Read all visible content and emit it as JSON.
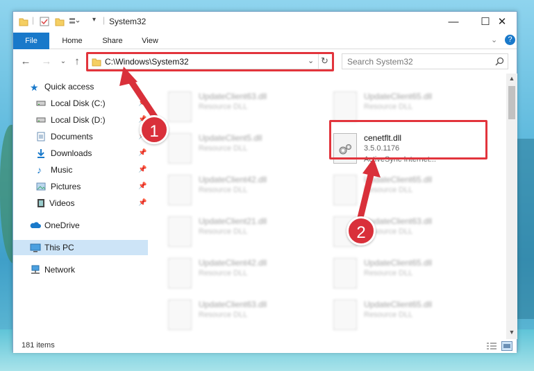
{
  "window": {
    "title": "System32",
    "controls": {
      "minimize": "—",
      "maximize": "☐",
      "close": "✕"
    }
  },
  "ribbon": {
    "tabs": [
      "File",
      "Home",
      "Share",
      "View"
    ]
  },
  "address": {
    "path": "C:\\Windows\\System32",
    "search_placeholder": "Search System32"
  },
  "nav": {
    "items": [
      {
        "label": "Quick access",
        "icon": "star-icon",
        "pinned": false
      },
      {
        "label": "Local Disk (C:)",
        "icon": "drive-icon",
        "pinned": true
      },
      {
        "label": "Local Disk (D:)",
        "icon": "drive-icon",
        "pinned": true
      },
      {
        "label": "Documents",
        "icon": "documents-icon",
        "pinned": true
      },
      {
        "label": "Downloads",
        "icon": "download-icon",
        "pinned": true
      },
      {
        "label": "Music",
        "icon": "music-icon",
        "pinned": true
      },
      {
        "label": "Pictures",
        "icon": "pictures-icon",
        "pinned": true
      },
      {
        "label": "Videos",
        "icon": "video-icon",
        "pinned": true
      },
      {
        "label": "OneDrive",
        "icon": "cloud-icon",
        "pinned": false
      },
      {
        "label": "This PC",
        "icon": "pc-icon",
        "pinned": false
      },
      {
        "label": "Network",
        "icon": "network-icon",
        "pinned": false
      }
    ],
    "selected": "This PC"
  },
  "files": {
    "left": [
      {
        "name": "UpdateClient63.dll",
        "desc": "Resource DLL"
      },
      {
        "name": "UpdateClient5.dll",
        "desc": "Resource DLL"
      },
      {
        "name": "UpdateClient42.dll",
        "desc": "Resource DLL"
      },
      {
        "name": "UpdateClient21.dll",
        "desc": "Resource DLL"
      },
      {
        "name": "UpdateClient42.dll",
        "desc": "Resource DLL"
      },
      {
        "name": "UpdateClient63.dll",
        "desc": "Resource DLL"
      }
    ],
    "right": [
      {
        "name": "UpdateClient65.dll",
        "desc": "Resource DLL"
      },
      {
        "name": "cenetflt.dll",
        "desc": "3.5.0.1176",
        "desc2": "ActiveSync Internet..."
      },
      {
        "name": "UpdateClient65.dll",
        "desc": "Resource DLL"
      },
      {
        "name": "UpdateClient63.dll",
        "desc": "Resource DLL"
      },
      {
        "name": "UpdateClient65.dll",
        "desc": "Resource DLL"
      },
      {
        "name": "UpdateClient65.dll",
        "desc": "Resource DLL"
      }
    ]
  },
  "status": {
    "item_count": "181 items"
  },
  "callouts": {
    "step1": "1",
    "step2": "2"
  },
  "colors": {
    "accent": "#1979ca",
    "highlight": "#e2343c",
    "badge": "#d9303a"
  }
}
